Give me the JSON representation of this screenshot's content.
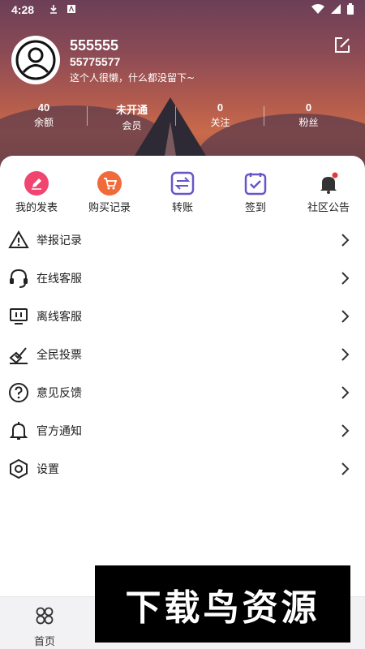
{
  "status_bar": {
    "time": "4:28",
    "download_icon": "download-icon",
    "app_icon": "a-icon"
  },
  "profile": {
    "username": "555555",
    "user_id": "55775577",
    "bio": "这个人很懒，什么都没留下~",
    "edit_icon": "edit-icon"
  },
  "stats": [
    {
      "value": "40",
      "label": "余额"
    },
    {
      "value": "未开通",
      "label": "会员"
    },
    {
      "value": "0",
      "label": "关注"
    },
    {
      "value": "0",
      "label": "粉丝"
    }
  ],
  "quick_actions": [
    {
      "label": "我的发表",
      "icon": "pen-icon",
      "color": "#f1446f"
    },
    {
      "label": "购买记录",
      "icon": "cart-icon",
      "color": "#f06a3a"
    },
    {
      "label": "转账",
      "icon": "transfer-icon",
      "color": "#6a54c9"
    },
    {
      "label": "签到",
      "icon": "checkin-icon",
      "color": "#6a54c9"
    },
    {
      "label": "社区公告",
      "icon": "bell-icon",
      "color": "#e53935"
    }
  ],
  "menu_items": [
    {
      "label": "举报记录",
      "icon": "warning-icon"
    },
    {
      "label": "在线客服",
      "icon": "headset-icon"
    },
    {
      "label": "离线客服",
      "icon": "monitor-icon"
    },
    {
      "label": "全民投票",
      "icon": "vote-icon"
    },
    {
      "label": "意见反馈",
      "icon": "question-icon"
    },
    {
      "label": "官方通知",
      "icon": "bell-outline-icon"
    },
    {
      "label": "设置",
      "icon": "hexagon-settings-icon"
    }
  ],
  "bottom_nav": {
    "home_label": "首页"
  },
  "overlay_text": "下载鸟资源"
}
